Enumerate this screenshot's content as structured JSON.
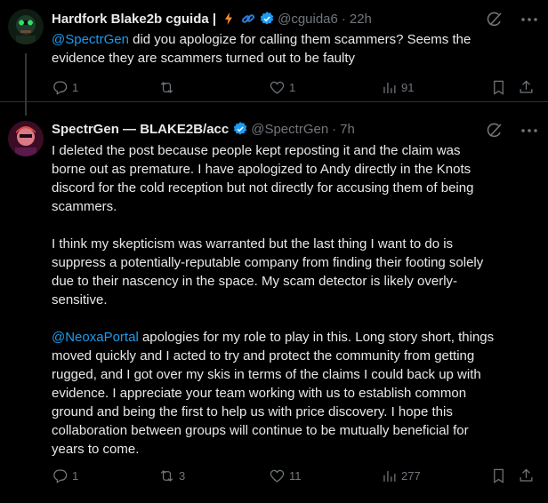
{
  "tweets": [
    {
      "author_name": "Hardfork Blake2b cguida |",
      "handle": "@cguida6",
      "time": "22h",
      "mention": "@SpectrGen",
      "text_lines": [
        " did you apologize for calling them scammers? Seems the",
        "evidence they are scammers turned out to be faulty"
      ],
      "stats": {
        "replies": "1",
        "retweets": "",
        "likes": "1",
        "views": "91"
      },
      "colors": {
        "verified": "#1d9bf0",
        "emoji_bolt": "#f58b2a",
        "emoji_link": "#2f7bd8"
      }
    },
    {
      "author_name": "SpectrGen — BLAKE2B/acc",
      "handle": "@SpectrGen",
      "time": "7h",
      "paragraph1": [
        "I deleted the post because people kept reposting it and the claim was",
        "borne out as premature. I have apologized to Andy directly in the Knots",
        "discord for the cold reception but not directly for accusing them of being",
        "scammers."
      ],
      "paragraph2": [
        "I think my skepticism was warranted but the last thing I want to do is",
        "suppress a potentially-reputable company from finding their footing solely",
        "due to their nascency in the space. My scam detector is likely overly-",
        "sensitive."
      ],
      "paragraph3_mention": "@NeoxaPortal",
      "paragraph3": [
        " apologies for my role to play in this. Long story short, things",
        "moved quickly and I acted to try and protect the community from getting",
        "rugged, and I got over my skis in terms of the claims I could back up with",
        "evidence. I appreciate your team working with us to establish common",
        "ground and being the first to help us with price discovery. I hope this",
        "collaboration between groups will continue to be mutually beneficial for",
        "years to come."
      ],
      "stats": {
        "replies": "1",
        "retweets": "3",
        "likes": "11",
        "views": "277"
      }
    }
  ],
  "colors": {
    "background": "#000000",
    "text": "#e7e9ea",
    "muted": "#71767b",
    "link": "#1d9bf0"
  },
  "icons": {
    "reply": "speech-bubble-icon",
    "retweet": "retweet-icon",
    "like": "heart-icon",
    "views": "bar-chart-icon",
    "bookmark": "bookmark-icon",
    "share": "share-icon",
    "grok": "grok-icon",
    "more": "more-icon"
  }
}
